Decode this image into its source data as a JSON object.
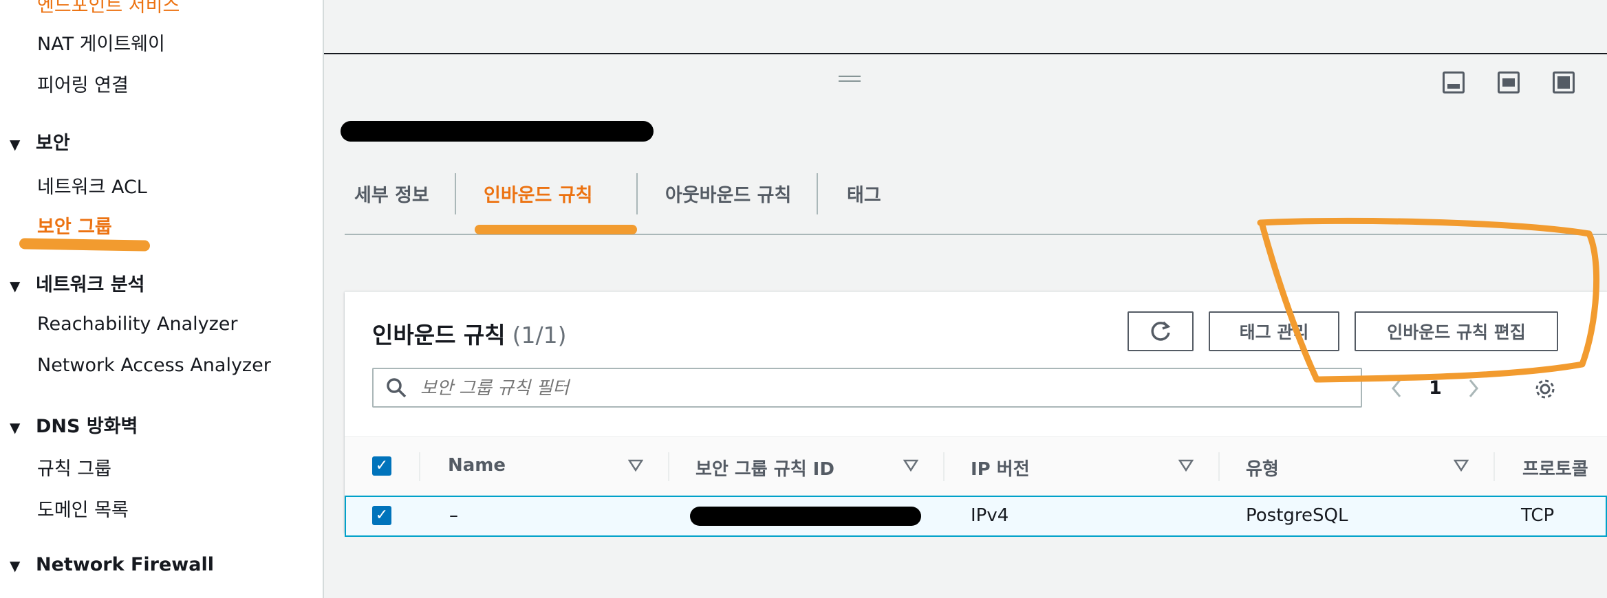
{
  "sidebar": {
    "cut_item": "엔드포인트 서비스",
    "items_top": [
      {
        "label": "NAT 게이트웨이"
      },
      {
        "label": "피어링 연결"
      }
    ],
    "security": {
      "title": "보안",
      "items": [
        {
          "label": "네트워크 ACL"
        },
        {
          "label": "보안 그룹"
        }
      ]
    },
    "network_analysis": {
      "title": "네트워크 분석",
      "items": [
        {
          "label": "Reachability Analyzer"
        },
        {
          "label": "Network Access Analyzer"
        }
      ]
    },
    "dns_firewall": {
      "title": "DNS 방화벽",
      "items": [
        {
          "label": "규칙 그룹"
        },
        {
          "label": "도메인 목록"
        }
      ]
    },
    "network_firewall": {
      "title": "Network Firewall"
    }
  },
  "detail": {
    "tabs": [
      {
        "label": "세부 정보"
      },
      {
        "label": "인바운드 규칙"
      },
      {
        "label": "아웃바운드 규칙"
      },
      {
        "label": "태그"
      }
    ]
  },
  "inbound": {
    "title": "인바운드 규칙",
    "count": "(1/1)",
    "refresh_icon": "refresh-icon",
    "manage_tags_label": "태그 관리",
    "edit_rules_label": "인바운드 규칙 편집",
    "search_placeholder": "보안 그룹 규칙 필터",
    "page": "1",
    "columns": [
      {
        "label": "Name"
      },
      {
        "label": "보안 그룹 규칙 ID"
      },
      {
        "label": "IP 버전"
      },
      {
        "label": "유형"
      },
      {
        "label": "프로토콜"
      }
    ],
    "rows": [
      {
        "name": "–",
        "ip_version": "IPv4",
        "type": "PostgreSQL",
        "protocol": "TCP"
      }
    ]
  },
  "colors": {
    "accent": "#ec7211",
    "annotation": "#f29b2f",
    "checkbox": "#0073bb",
    "row_selected_border": "#00a1c9"
  }
}
